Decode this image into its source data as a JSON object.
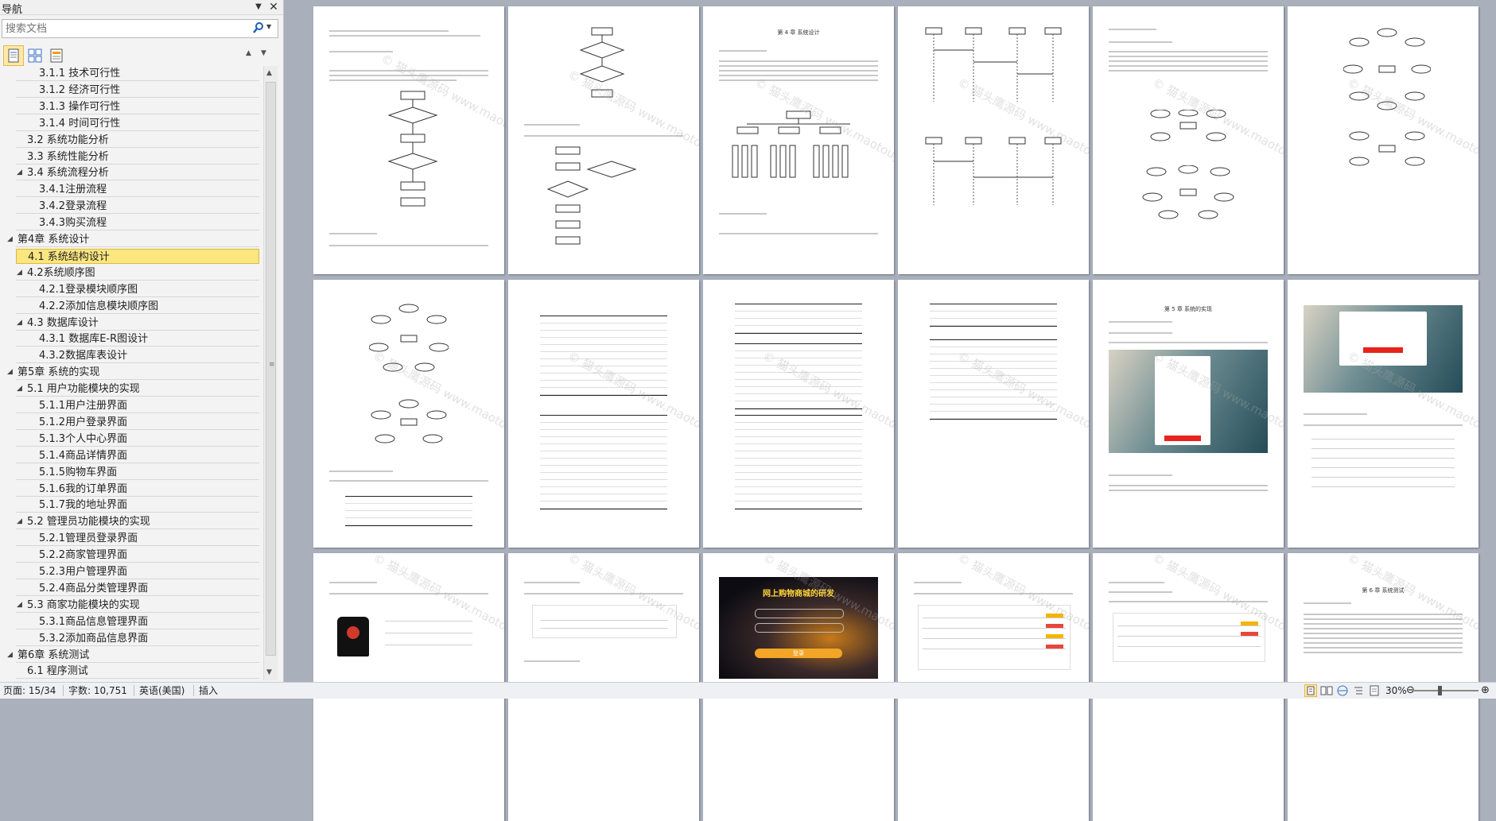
{
  "nav": {
    "title": "导航",
    "search_placeholder": "搜索文档",
    "tree": [
      {
        "label": "3.1.1 技术可行性",
        "level": 3
      },
      {
        "label": "3.1.2 经济可行性",
        "level": 3
      },
      {
        "label": "3.1.3 操作可行性",
        "level": 3
      },
      {
        "label": "3.1.4 时间可行性",
        "level": 3
      },
      {
        "label": "3.2 系统功能分析",
        "level": 2
      },
      {
        "label": "3.3 系统性能分析",
        "level": 2
      },
      {
        "label": "3.4 系统流程分析",
        "level": 2,
        "expanded": true
      },
      {
        "label": "3.4.1注册流程",
        "level": 3
      },
      {
        "label": "3.4.2登录流程",
        "level": 3
      },
      {
        "label": "3.4.3购买流程",
        "level": 3
      },
      {
        "label": "第4章  系统设计",
        "level": 1,
        "expanded": true
      },
      {
        "label": "4.1 系统结构设计",
        "level": 2,
        "selected": true
      },
      {
        "label": "4.2系统顺序图",
        "level": 2,
        "expanded": true
      },
      {
        "label": "4.2.1登录模块顺序图",
        "level": 3
      },
      {
        "label": "4.2.2添加信息模块顺序图",
        "level": 3
      },
      {
        "label": "4.3 数据库设计",
        "level": 2,
        "expanded": true
      },
      {
        "label": "4.3.1 数据库E-R图设计",
        "level": 3
      },
      {
        "label": "4.3.2数据库表设计",
        "level": 3
      },
      {
        "label": "第5章  系统的实现",
        "level": 1,
        "expanded": true
      },
      {
        "label": "5.1 用户功能模块的实现",
        "level": 2,
        "expanded": true
      },
      {
        "label": "5.1.1用户注册界面",
        "level": 3
      },
      {
        "label": "5.1.2用户登录界面",
        "level": 3
      },
      {
        "label": "5.1.3个人中心界面",
        "level": 3
      },
      {
        "label": "5.1.4商品详情界面",
        "level": 3
      },
      {
        "label": "5.1.5购物车界面",
        "level": 3
      },
      {
        "label": "5.1.6我的订单界面",
        "level": 3
      },
      {
        "label": "5.1.7我的地址界面",
        "level": 3
      },
      {
        "label": "5.2 管理员功能模块的实现",
        "level": 2,
        "expanded": true
      },
      {
        "label": "5.2.1管理员登录界面",
        "level": 3
      },
      {
        "label": "5.2.2商家管理界面",
        "level": 3
      },
      {
        "label": "5.2.3用户管理界面",
        "level": 3
      },
      {
        "label": "5.2.4商品分类管理界面",
        "level": 3
      },
      {
        "label": "5.3 商家功能模块的实现",
        "level": 2,
        "expanded": true
      },
      {
        "label": "5.3.1商品信息管理界面",
        "level": 3
      },
      {
        "label": "5.3.2添加商品信息界面",
        "level": 3
      },
      {
        "label": "第6章  系统测试",
        "level": 1,
        "expanded": true
      },
      {
        "label": "6.1 程序测试",
        "level": 2
      }
    ]
  },
  "pages": {
    "chapter4_heading": "第 4 章  系统设计",
    "chapter5_heading": "第 5 章  系统的实现",
    "chapter6_heading": "第 6 章  系统测试",
    "login_banner": "网上购物商城的研发",
    "login_button": "登录",
    "watermark": "© 猫头鹰源码 www.maotouyingcc.com"
  },
  "status": {
    "page": "页面: 15/34",
    "words": "字数: 10,751",
    "language": "英语(美国)",
    "mode": "插入",
    "zoom": "30%",
    "zoom_fraction": 0.42
  },
  "colors": {
    "selection": "#fbe680",
    "doc_bg": "#a9b0bc",
    "login_button": "#e8231d"
  }
}
